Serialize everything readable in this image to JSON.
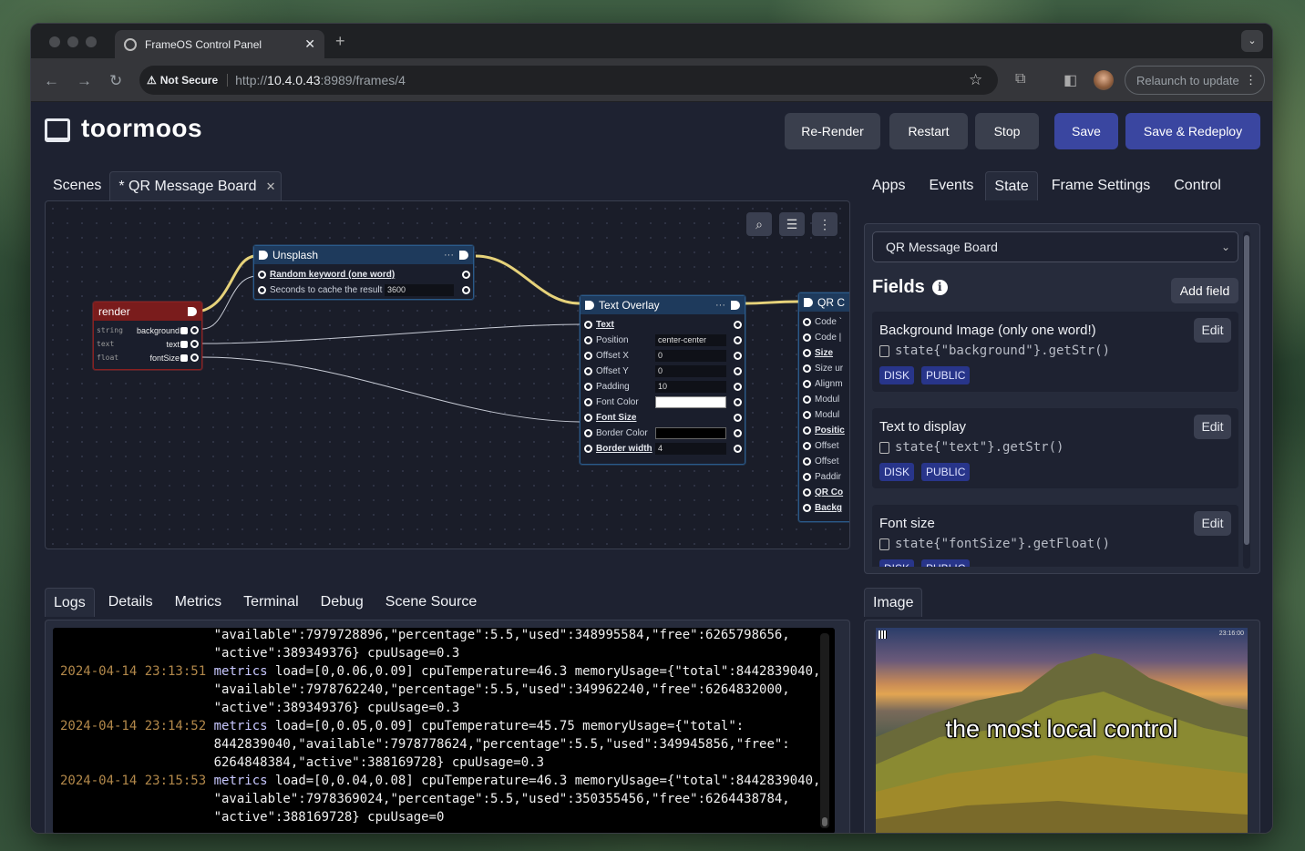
{
  "browser": {
    "tab_title": "FrameOS Control Panel",
    "security_label": "Not Secure",
    "url_scheme": "http://",
    "url_host": "10.4.0.43",
    "url_rest": ":8989/frames/4",
    "relaunch_label": "Relaunch to update"
  },
  "header": {
    "brand": "toormoos",
    "buttons": {
      "rerender": "Re-Render",
      "restart": "Restart",
      "stop": "Stop",
      "save": "Save",
      "save_redeploy": "Save & Redeploy"
    }
  },
  "editor": {
    "tabs": [
      {
        "label": "Scenes"
      },
      {
        "label": "* QR Message Board"
      }
    ],
    "nodes": {
      "render": {
        "title": "render",
        "fields": [
          {
            "type": "string",
            "name": "background"
          },
          {
            "type": "text",
            "name": "text"
          },
          {
            "type": "float",
            "name": "fontSize"
          }
        ]
      },
      "unsplash": {
        "title": "Unsplash",
        "fields": [
          {
            "name": "Random keyword (one word)"
          },
          {
            "name": "Seconds to cache the result",
            "value": "3600"
          }
        ]
      },
      "text_overlay": {
        "title": "Text Overlay",
        "fields": [
          {
            "name": "Text"
          },
          {
            "name": "Position",
            "value": "center-center"
          },
          {
            "name": "Offset X",
            "value": "0"
          },
          {
            "name": "Offset Y",
            "value": "0"
          },
          {
            "name": "Padding",
            "value": "10"
          },
          {
            "name": "Font Color"
          },
          {
            "name": "Font Size"
          },
          {
            "name": "Border Color"
          },
          {
            "name": "Border width",
            "value": "4"
          }
        ]
      },
      "qr": {
        "title": "QR C",
        "fields": [
          "Code `",
          "Code |",
          "Size",
          "Size ur",
          "Alignm",
          "Modul",
          "Modul",
          "Positic",
          "Offset",
          "Offset",
          "Paddir",
          "QR Co",
          "Backg"
        ]
      }
    }
  },
  "right_panel": {
    "tabs": [
      {
        "label": "Apps"
      },
      {
        "label": "Events"
      },
      {
        "label": "State"
      },
      {
        "label": "Frame Settings"
      },
      {
        "label": "Control"
      }
    ],
    "scene_select": "QR Message Board",
    "fields_title": "Fields",
    "add_field": "Add field",
    "edit_label": "Edit",
    "fields": [
      {
        "name": "Background Image (only one word!)",
        "code": "state{\"background\"}.getStr()",
        "tags": [
          "DISK",
          "PUBLIC"
        ]
      },
      {
        "name": "Text to display",
        "code": "state{\"text\"}.getStr()",
        "tags": [
          "DISK",
          "PUBLIC"
        ]
      },
      {
        "name": "Font size",
        "code": "state{\"fontSize\"}.getFloat()",
        "tags": [
          "DISK",
          "PUBLIC"
        ]
      }
    ]
  },
  "bottom_tabs": [
    {
      "label": "Logs"
    },
    {
      "label": "Details"
    },
    {
      "label": "Metrics"
    },
    {
      "label": "Terminal"
    },
    {
      "label": "Debug"
    },
    {
      "label": "Scene Source"
    }
  ],
  "logs": [
    {
      "ts": "",
      "event": "",
      "text": "\"available\":7979728896,\"percentage\":5.5,\"used\":348995584,\"free\":6265798656,"
    },
    {
      "ts": "",
      "event": "",
      "text": "\"active\":389349376} cpuUsage=0.3"
    },
    {
      "ts": "2024-04-14 23:13:51",
      "event": "metrics",
      "text": " load=[0,0.06,0.09] cpuTemperature=46.3 memoryUsage={\"total\":8442839040,"
    },
    {
      "ts": "",
      "event": "",
      "text": "\"available\":7978762240,\"percentage\":5.5,\"used\":349962240,\"free\":6264832000,"
    },
    {
      "ts": "",
      "event": "",
      "text": "\"active\":389349376} cpuUsage=0.3"
    },
    {
      "ts": "2024-04-14 23:14:52",
      "event": "metrics",
      "text": " load=[0,0.05,0.09] cpuTemperature=45.75 memoryUsage={\"total\":"
    },
    {
      "ts": "",
      "event": "",
      "text": "8442839040,\"available\":7978778624,\"percentage\":5.5,\"used\":349945856,\"free\":"
    },
    {
      "ts": "",
      "event": "",
      "text": "6264848384,\"active\":388169728} cpuUsage=0.3"
    },
    {
      "ts": "2024-04-14 23:15:53",
      "event": "metrics",
      "text": " load=[0,0.04,0.08] cpuTemperature=46.3 memoryUsage={\"total\":8442839040,"
    },
    {
      "ts": "",
      "event": "",
      "text": "\"available\":7978369024,\"percentage\":5.5,\"used\":350355456,\"free\":6264438784,"
    },
    {
      "ts": "",
      "event": "",
      "text": "\"active\":388169728} cpuUsage=0"
    }
  ],
  "image_panel": {
    "tab": "Image",
    "caption": "the most local control",
    "timestamp": "23:16:00"
  }
}
